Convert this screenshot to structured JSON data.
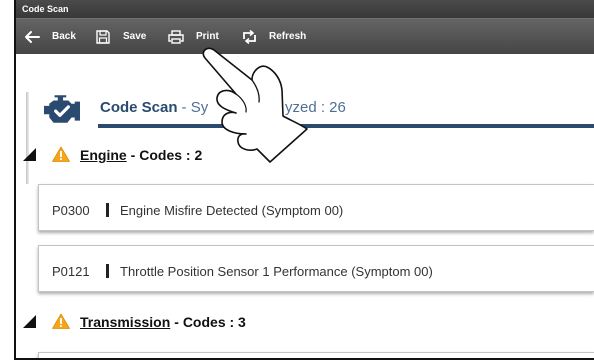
{
  "window": {
    "title": "Code Scan"
  },
  "toolbar": {
    "items": [
      {
        "label": "Back",
        "icon": "back-arrow-icon"
      },
      {
        "label": "Save",
        "icon": "save-icon"
      },
      {
        "label": "Print",
        "icon": "print-icon"
      },
      {
        "label": "Refresh",
        "icon": "refresh-icon"
      }
    ]
  },
  "header": {
    "icon": "engine-check-icon",
    "title": "Code Scan",
    "subtitle_left": "- Sy",
    "subtitle_right": "yzed : 26"
  },
  "categories": [
    {
      "name": "Engine",
      "count_label": "- Codes : 2",
      "icon": "warning-icon",
      "expanded": true,
      "codes": [
        {
          "code": "P0300",
          "description": "Engine Misfire Detected (Symptom 00)"
        },
        {
          "code": "P0121",
          "description": "Throttle Position Sensor 1 Performance (Symptom 00)"
        }
      ]
    },
    {
      "name": "Transmission",
      "count_label": "- Codes : 3",
      "icon": "warning-icon",
      "expanded": true
    }
  ],
  "overlay": {
    "icon": "pointing-hand-icon"
  },
  "colors": {
    "toolbar": "#555555",
    "accent": "#2b4a6f",
    "warning": "#f4a51c",
    "text": "#111111"
  }
}
